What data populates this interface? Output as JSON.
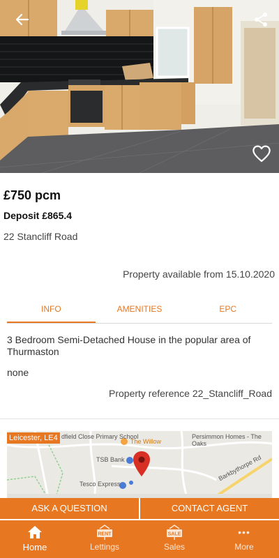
{
  "listing": {
    "price": "£750 pcm",
    "deposit": "Deposit £865.4",
    "address": "22 Stancliff Road",
    "availability": "Property available from 15.10.2020",
    "description": "3 Bedroom Semi-Detached House in the popular area of Thurmaston",
    "note": "none",
    "reference": "Property reference 22_Stancliff_Road"
  },
  "tabs": [
    {
      "label": "INFO",
      "active": true
    },
    {
      "label": "AMENITIES",
      "active": false
    },
    {
      "label": "EPC",
      "active": false
    }
  ],
  "map": {
    "location_label": "Leicester, LE4",
    "places": [
      "dfield Close Primary School",
      "The Willow",
      "TSB Bank",
      "Tesco Express",
      "Persimmon Homes - The Oaks",
      "Barkbythorpe Rd"
    ]
  },
  "actions": {
    "ask": "ASK A QUESTION",
    "contact": "CONTACT AGENT"
  },
  "nav": {
    "items": [
      {
        "label": "Home",
        "icon": "home-icon",
        "active": true
      },
      {
        "label": "Lettings",
        "icon": "rent-sign-icon",
        "badge": "RENT",
        "active": false
      },
      {
        "label": "Sales",
        "icon": "sale-sign-icon",
        "badge": "SALE",
        "active": false
      },
      {
        "label": "More",
        "icon": "more-dots-icon",
        "badge": "•••",
        "active": false
      }
    ]
  },
  "colors": {
    "accent": "#e87722",
    "map_pin": "#d93025"
  },
  "icons": {
    "back": "arrow-left-icon",
    "share": "share-icon",
    "favourite": "heart-outline-icon",
    "pin": "map-pin-icon"
  }
}
